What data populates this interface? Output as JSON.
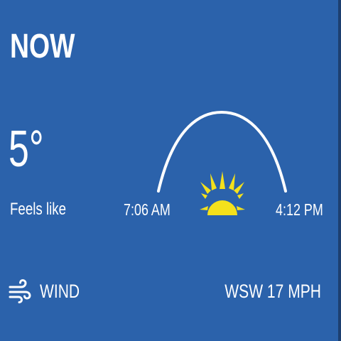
{
  "colors": {
    "background": "#2b62ab",
    "text": "#ffffff",
    "sun": "#f4e11c",
    "arc": "#ffffff"
  },
  "header": {
    "title": "NOW"
  },
  "current": {
    "temperature": "5°",
    "feels_like_label": "Feels like"
  },
  "sun": {
    "sunrise": "7:06 AM",
    "sunset": "4:12 PM",
    "icon": "sun-icon"
  },
  "wind": {
    "icon": "wind-icon",
    "label": "WIND",
    "value": "WSW 17 MPH"
  }
}
